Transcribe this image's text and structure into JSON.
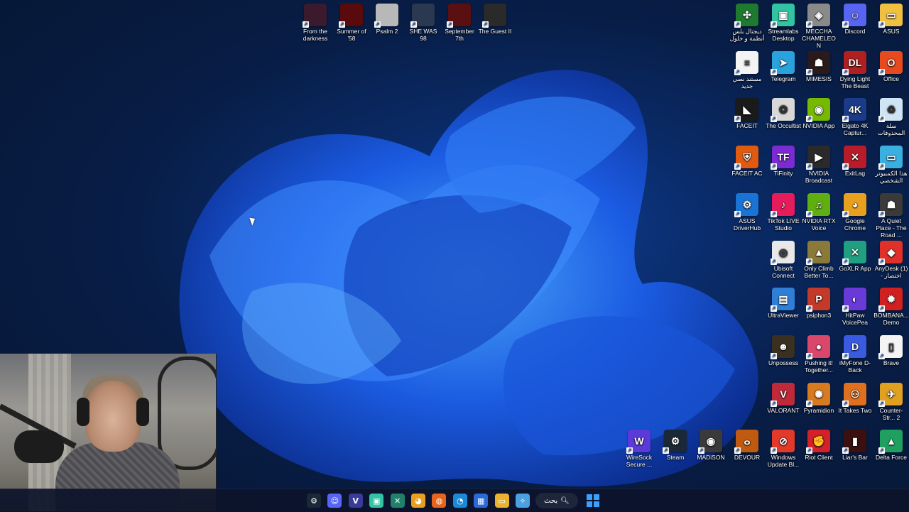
{
  "desktop": {
    "top_icons": [
      {
        "label": "From the darkness",
        "icon": "game-thumbnail",
        "color": "#3b1a2e"
      },
      {
        "label": "Summer of '58",
        "icon": "game-thumbnail",
        "color": "#5a0a0a"
      },
      {
        "label": "Psalm 2",
        "icon": "game-thumbnail",
        "color": "#d0d0d0"
      },
      {
        "label": "SHE WAS 98",
        "icon": "game-thumbnail",
        "color": "#2a3850"
      },
      {
        "label": "September 7th",
        "icon": "game-thumbnail",
        "color": "#5a1010"
      },
      {
        "label": "The Guest II",
        "icon": "game-thumbnail",
        "color": "#2a2a2a"
      }
    ],
    "right_columns": [
      [
        {
          "label": "ديجتال بلس أنظمة و حلول",
          "icon": "digital-plus-icon",
          "color": "#1e7a2e",
          "glyph": "✣"
        },
        {
          "label": "مستند نصي جديد",
          "icon": "text-document-icon",
          "color": "#f4f4f4",
          "glyph": "≡"
        },
        {
          "label": "FACEIT",
          "icon": "faceit-icon",
          "color": "#1a1a1a",
          "glyph": "◣"
        },
        {
          "label": "FACEIT AC",
          "icon": "faceit-ac-icon",
          "color": "#e05a10",
          "glyph": "⛨"
        },
        {
          "label": "ASUS DriverHub",
          "icon": "asus-driverhub-icon",
          "color": "#1a74d6",
          "glyph": "⚙"
        }
      ],
      [
        {
          "label": "Streamlabs Desktop",
          "icon": "streamlabs-icon",
          "color": "#31c3a2",
          "glyph": "▣"
        },
        {
          "label": "Telegram",
          "icon": "telegram-icon",
          "color": "#2aa3dd",
          "glyph": "➤"
        },
        {
          "label": "The Occultist",
          "icon": "occultist-icon",
          "color": "#d8d8d8",
          "glyph": "✪"
        },
        {
          "label": "TiFinity",
          "icon": "tifinity-icon",
          "color": "#7a2bd1",
          "glyph": "TF"
        },
        {
          "label": "TikTok LIVE Studio",
          "icon": "tiktok-icon",
          "color": "#e41c5c",
          "glyph": "♪"
        },
        {
          "label": "Ubisoft Connect",
          "icon": "ubisoft-icon",
          "color": "#e8e8e8",
          "glyph": "◎"
        },
        {
          "label": "UltraViewer",
          "icon": "ultraviewer-icon",
          "color": "#2f7fd8",
          "glyph": "▤"
        },
        {
          "label": "Unpossess",
          "icon": "unpossess-icon",
          "color": "#3a3020",
          "glyph": "☻"
        },
        {
          "label": "VALORANT",
          "icon": "valorant-icon",
          "color": "#bf2a3a",
          "glyph": "V"
        },
        {
          "label": "Windows Update Bl...",
          "icon": "windows-update-icon",
          "color": "#e23a2a",
          "glyph": "⊘"
        }
      ],
      [
        {
          "label": "MECCHA CHAMELEON",
          "icon": "meccha-icon",
          "color": "#8a8a8a",
          "glyph": "◈"
        },
        {
          "label": "MIMESIS",
          "icon": "mimesis-icon",
          "color": "#2a1a1a",
          "glyph": "☗"
        },
        {
          "label": "NVIDIA App",
          "icon": "nvidia-app-icon",
          "color": "#76b900",
          "glyph": "◉"
        },
        {
          "label": "NVIDIA Broadcast",
          "icon": "nvidia-broadcast-icon",
          "color": "#2a2a2a",
          "glyph": "▶"
        },
        {
          "label": "NVIDIA RTX Voice",
          "icon": "nvidia-rtx-voice-icon",
          "color": "#5fae12",
          "glyph": "♫"
        },
        {
          "label": "Only Climb Better To...",
          "icon": "only-climb-icon",
          "color": "#8a7a3a",
          "glyph": "▲"
        },
        {
          "label": "psiphon3",
          "icon": "psiphon-icon",
          "color": "#c43a2a",
          "glyph": "P"
        },
        {
          "label": "Pushing it! Together...",
          "icon": "pushing-it-icon",
          "color": "#d9476a",
          "glyph": "●"
        },
        {
          "label": "Pyramidion",
          "icon": "pyramidion-icon",
          "color": "#d87a20",
          "glyph": "✺"
        },
        {
          "label": "Riot Client",
          "icon": "riot-client-icon",
          "color": "#d4202a",
          "glyph": "✊"
        }
      ],
      [
        {
          "label": "Discord",
          "icon": "discord-icon",
          "color": "#5865f2",
          "glyph": "☺"
        },
        {
          "label": "Dying Light The Beast",
          "icon": "dying-light-icon",
          "color": "#b02020",
          "glyph": "DL"
        },
        {
          "label": "Elgato 4K Captur...",
          "icon": "elgato-icon",
          "color": "#1a3a8a",
          "glyph": "4K"
        },
        {
          "label": "ExitLag",
          "icon": "exitlag-icon",
          "color": "#b81c2a",
          "glyph": "✕"
        },
        {
          "label": "Google Chrome",
          "icon": "chrome-icon",
          "color": "#e8a020",
          "glyph": "◕"
        },
        {
          "label": "GoXLR App",
          "icon": "goxlr-icon",
          "color": "#20a080",
          "glyph": "✕"
        },
        {
          "label": "HitPaw VoicePea",
          "icon": "hitpaw-icon",
          "color": "#6a3ad8",
          "glyph": "◐"
        },
        {
          "label": "iMyFone D-Back",
          "icon": "imyfone-icon",
          "color": "#3a5ae0",
          "glyph": "D"
        },
        {
          "label": "It Takes Two",
          "icon": "it-takes-two-icon",
          "color": "#e07020",
          "glyph": "⚇"
        },
        {
          "label": "Liar's Bar",
          "icon": "liars-bar-icon",
          "color": "#3a1010",
          "glyph": "▮"
        }
      ],
      [
        {
          "label": "ASUS",
          "icon": "folder-icon",
          "color": "#f0c040",
          "glyph": "▭"
        },
        {
          "label": "Office",
          "icon": "office-icon",
          "color": "#e84a20",
          "glyph": "O"
        },
        {
          "label": "سلة المحذوفات",
          "icon": "recycle-bin-icon",
          "color": "#cfe4f4",
          "glyph": "♻"
        },
        {
          "label": "هذا الكمبيوتر الشخصي",
          "icon": "this-pc-icon",
          "color": "#3ab0e0",
          "glyph": "▭"
        },
        {
          "label": "A Quiet Place - The Road ...",
          "icon": "quiet-place-icon",
          "color": "#3a3a3a",
          "glyph": "☗"
        },
        {
          "label": "AnyDesk (1) - اختصار",
          "icon": "anydesk-icon",
          "color": "#e0302a",
          "glyph": "◆"
        },
        {
          "label": "BOMBANA... Demo",
          "icon": "bombana-icon",
          "color": "#d02020",
          "glyph": "✹"
        },
        {
          "label": "Brave",
          "icon": "brave-file-icon",
          "color": "#f4f4f4",
          "glyph": "▯"
        },
        {
          "label": "Counter-Str... 2",
          "icon": "cs2-icon",
          "color": "#e0a020",
          "glyph": "✈"
        },
        {
          "label": "Delta Force",
          "icon": "delta-force-icon",
          "color": "#20a060",
          "glyph": "▲"
        }
      ]
    ],
    "bottom_row": [
      {
        "label": "WireSock Secure ...",
        "icon": "wiresock-icon",
        "color": "#5a3ad8",
        "glyph": "W"
      },
      {
        "label": "Steam",
        "icon": "steam-icon",
        "color": "#1b2838",
        "glyph": "⚙"
      },
      {
        "label": "MADiSON",
        "icon": "madison-icon",
        "color": "#3a3a3a",
        "glyph": "◉"
      },
      {
        "label": "DEVOUR",
        "icon": "devour-icon",
        "color": "#c05a10",
        "glyph": "ⴰ"
      }
    ]
  },
  "taskbar": {
    "search_label": "بحث",
    "items": [
      {
        "name": "steam-taskbar-icon",
        "glyph": "⚙",
        "color": "#1b2838"
      },
      {
        "name": "discord-taskbar-icon",
        "glyph": "☺",
        "color": "#5865f2"
      },
      {
        "name": "vpn-taskbar-icon",
        "glyph": "V",
        "color": "#3a3a9a"
      },
      {
        "name": "streamlabs-taskbar-icon",
        "glyph": "▣",
        "color": "#31c3a2"
      },
      {
        "name": "goxlr-taskbar-icon",
        "glyph": "✕",
        "color": "#20806a"
      },
      {
        "name": "chrome-taskbar-icon",
        "glyph": "◕",
        "color": "#e8a020"
      },
      {
        "name": "firefox-taskbar-icon",
        "glyph": "◍",
        "color": "#e8641a"
      },
      {
        "name": "edge-taskbar-icon",
        "glyph": "◔",
        "color": "#1a8ad8"
      },
      {
        "name": "store-taskbar-icon",
        "glyph": "▦",
        "color": "#2a6ad8"
      },
      {
        "name": "file-explorer-taskbar-icon",
        "glyph": "▭",
        "color": "#e8b430"
      },
      {
        "name": "copilot-taskbar-icon",
        "glyph": "✧",
        "color": "#4aa0e0"
      }
    ]
  }
}
